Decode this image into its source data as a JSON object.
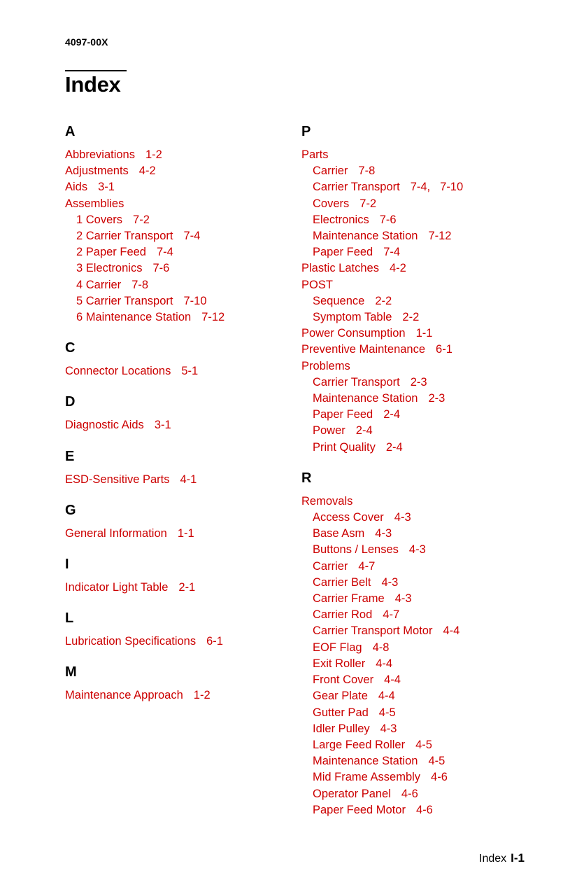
{
  "header": {
    "document_number": "4097-00X",
    "title": "Index"
  },
  "footer": {
    "label": "Index",
    "page": "I-1"
  },
  "colors": {
    "entry_red": "#CC0000",
    "heading_black": "#000000",
    "page_background": "#FFFFFF"
  },
  "columns": {
    "left": [
      {
        "letter": "A",
        "entries": [
          {
            "text": "Abbreviations",
            "pages": [
              "1-2"
            ],
            "level": 0
          },
          {
            "text": "Adjustments",
            "pages": [
              "4-2"
            ],
            "level": 0
          },
          {
            "text": "Aids",
            "pages": [
              "3-1"
            ],
            "level": 0
          },
          {
            "text": "Assemblies",
            "pages": [],
            "level": 0
          },
          {
            "text": "1 Covers",
            "pages": [
              "7-2"
            ],
            "level": 1
          },
          {
            "text": "2 Carrier Transport",
            "pages": [
              "7-4"
            ],
            "level": 1
          },
          {
            "text": "2 Paper Feed",
            "pages": [
              "7-4"
            ],
            "level": 1
          },
          {
            "text": "3 Electronics",
            "pages": [
              "7-6"
            ],
            "level": 1
          },
          {
            "text": "4 Carrier",
            "pages": [
              "7-8"
            ],
            "level": 1
          },
          {
            "text": "5 Carrier Transport",
            "pages": [
              "7-10"
            ],
            "level": 1
          },
          {
            "text": "6 Maintenance Station",
            "pages": [
              "7-12"
            ],
            "level": 1
          }
        ]
      },
      {
        "letter": "C",
        "entries": [
          {
            "text": "Connector Locations",
            "pages": [
              "5-1"
            ],
            "level": 0
          }
        ]
      },
      {
        "letter": "D",
        "entries": [
          {
            "text": "Diagnostic Aids",
            "pages": [
              "3-1"
            ],
            "level": 0
          }
        ]
      },
      {
        "letter": "E",
        "entries": [
          {
            "text": "ESD-Sensitive Parts",
            "pages": [
              "4-1"
            ],
            "level": 0
          }
        ]
      },
      {
        "letter": "G",
        "entries": [
          {
            "text": "General Information",
            "pages": [
              "1-1"
            ],
            "level": 0
          }
        ]
      },
      {
        "letter": "I",
        "entries": [
          {
            "text": "Indicator Light Table",
            "pages": [
              "2-1"
            ],
            "level": 0
          }
        ]
      },
      {
        "letter": "L",
        "entries": [
          {
            "text": "Lubrication Specifications",
            "pages": [
              "6-1"
            ],
            "level": 0
          }
        ]
      },
      {
        "letter": "M",
        "entries": [
          {
            "text": "Maintenance Approach",
            "pages": [
              "1-2"
            ],
            "level": 0
          }
        ]
      }
    ],
    "right": [
      {
        "letter": "P",
        "entries": [
          {
            "text": "Parts",
            "pages": [],
            "level": 0
          },
          {
            "text": "Carrier",
            "pages": [
              "7-8"
            ],
            "level": 1
          },
          {
            "text": "Carrier Transport",
            "pages": [
              "7-4,",
              "7-10"
            ],
            "level": 1
          },
          {
            "text": "Covers",
            "pages": [
              "7-2"
            ],
            "level": 1
          },
          {
            "text": "Electronics",
            "pages": [
              "7-6"
            ],
            "level": 1
          },
          {
            "text": "Maintenance Station",
            "pages": [
              "7-12"
            ],
            "level": 1
          },
          {
            "text": "Paper Feed",
            "pages": [
              "7-4"
            ],
            "level": 1
          },
          {
            "text": "Plastic Latches",
            "pages": [
              "4-2"
            ],
            "level": 0
          },
          {
            "text": "POST",
            "pages": [],
            "level": 0
          },
          {
            "text": "Sequence",
            "pages": [
              "2-2"
            ],
            "level": 1
          },
          {
            "text": "Symptom Table",
            "pages": [
              "2-2"
            ],
            "level": 1
          },
          {
            "text": "Power Consumption",
            "pages": [
              "1-1"
            ],
            "level": 0
          },
          {
            "text": "Preventive Maintenance",
            "pages": [
              "6-1"
            ],
            "level": 0
          },
          {
            "text": "Problems",
            "pages": [],
            "level": 0
          },
          {
            "text": "Carrier Transport",
            "pages": [
              "2-3"
            ],
            "level": 1
          },
          {
            "text": "Maintenance Station",
            "pages": [
              "2-3"
            ],
            "level": 1
          },
          {
            "text": "Paper Feed",
            "pages": [
              "2-4"
            ],
            "level": 1
          },
          {
            "text": "Power",
            "pages": [
              "2-4"
            ],
            "level": 1
          },
          {
            "text": "Print Quality",
            "pages": [
              "2-4"
            ],
            "level": 1
          }
        ]
      },
      {
        "letter": "R",
        "entries": [
          {
            "text": "Removals",
            "pages": [],
            "level": 0
          },
          {
            "text": "Access Cover",
            "pages": [
              "4-3"
            ],
            "level": 1
          },
          {
            "text": "Base Asm",
            "pages": [
              "4-3"
            ],
            "level": 1
          },
          {
            "text": "Buttons / Lenses",
            "pages": [
              "4-3"
            ],
            "level": 1
          },
          {
            "text": "Carrier",
            "pages": [
              "4-7"
            ],
            "level": 1
          },
          {
            "text": "Carrier Belt",
            "pages": [
              "4-3"
            ],
            "level": 1
          },
          {
            "text": "Carrier Frame",
            "pages": [
              "4-3"
            ],
            "level": 1
          },
          {
            "text": "Carrier Rod",
            "pages": [
              "4-7"
            ],
            "level": 1
          },
          {
            "text": "Carrier Transport Motor",
            "pages": [
              "4-4"
            ],
            "level": 1
          },
          {
            "text": "EOF Flag",
            "pages": [
              "4-8"
            ],
            "level": 1
          },
          {
            "text": "Exit Roller",
            "pages": [
              "4-4"
            ],
            "level": 1
          },
          {
            "text": "Front Cover",
            "pages": [
              "4-4"
            ],
            "level": 1
          },
          {
            "text": "Gear Plate",
            "pages": [
              "4-4"
            ],
            "level": 1
          },
          {
            "text": "Gutter Pad",
            "pages": [
              "4-5"
            ],
            "level": 1
          },
          {
            "text": "Idler Pulley",
            "pages": [
              "4-3"
            ],
            "level": 1
          },
          {
            "text": "Large Feed Roller",
            "pages": [
              "4-5"
            ],
            "level": 1
          },
          {
            "text": "Maintenance Station",
            "pages": [
              "4-5"
            ],
            "level": 1
          },
          {
            "text": "Mid Frame Assembly",
            "pages": [
              "4-6"
            ],
            "level": 1
          },
          {
            "text": "Operator Panel",
            "pages": [
              "4-6"
            ],
            "level": 1
          },
          {
            "text": "Paper Feed Motor",
            "pages": [
              "4-6"
            ],
            "level": 1
          }
        ]
      }
    ]
  }
}
